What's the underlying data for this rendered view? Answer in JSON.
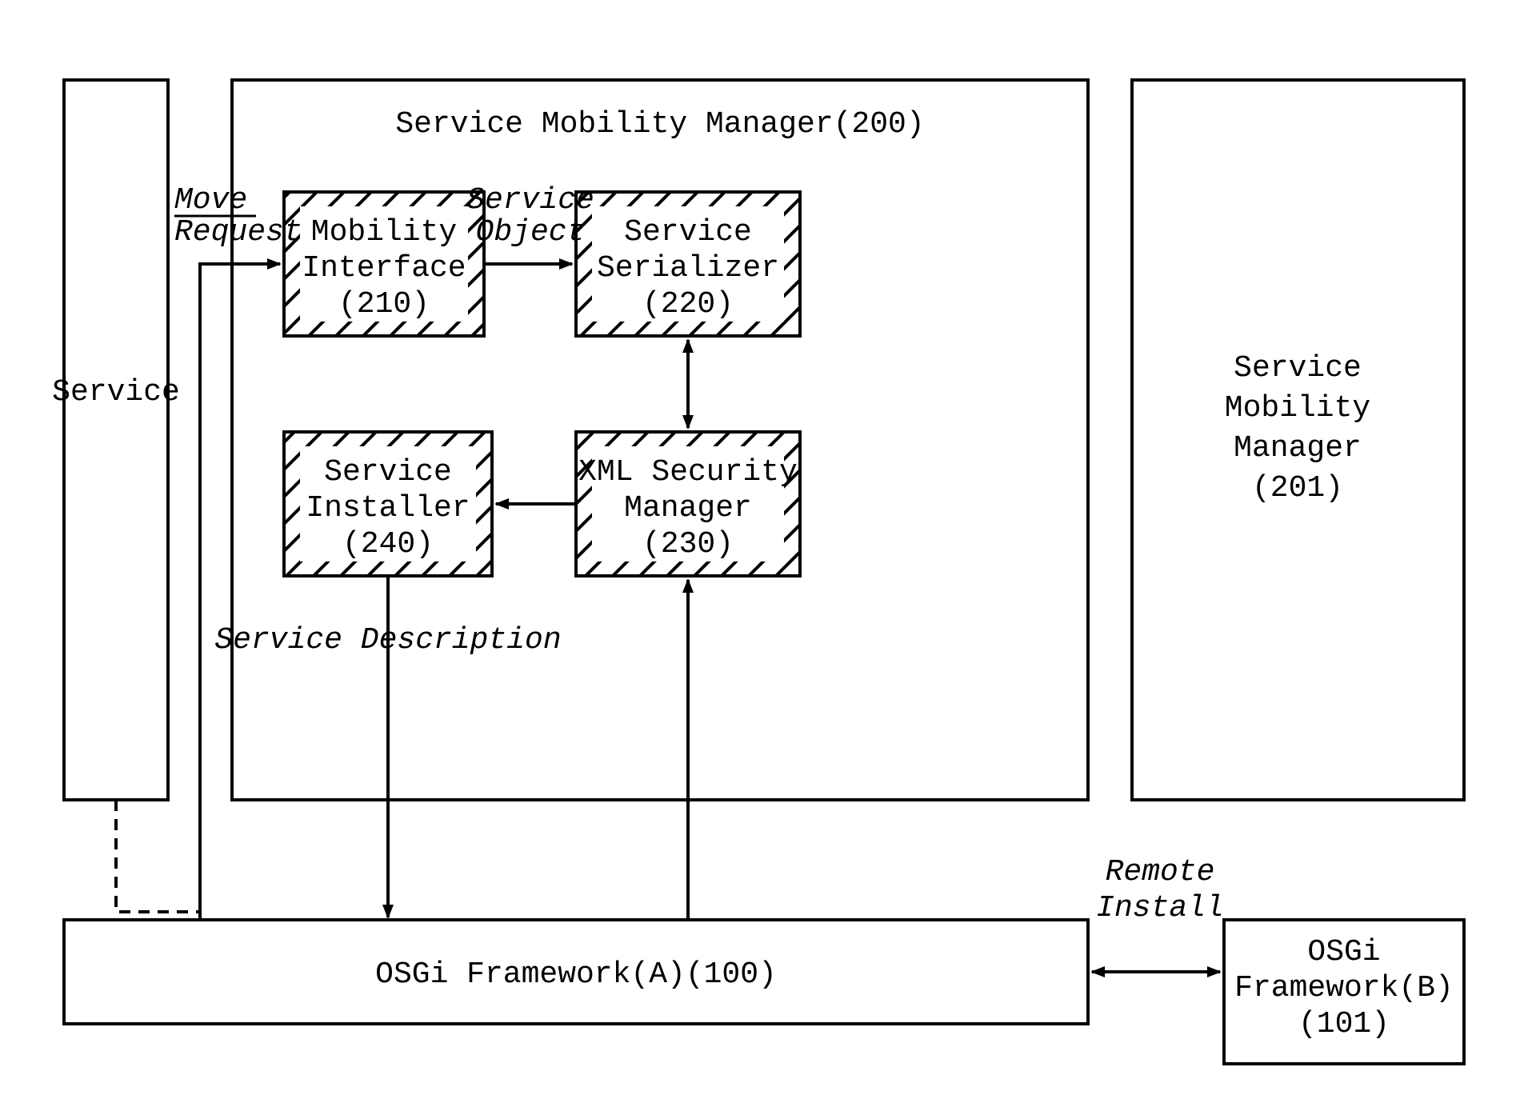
{
  "blocks": {
    "service": {
      "line1": "Service"
    },
    "smm200": {
      "title": "Service Mobility Manager(200)",
      "mi": {
        "l1": "Mobility",
        "l2": "Interface",
        "l3": "(210)"
      },
      "ss": {
        "l1": "Service",
        "l2": "Serializer",
        "l3": "(220)"
      },
      "xs": {
        "l1": "XML Security",
        "l2": "Manager",
        "l3": "(230)"
      },
      "si": {
        "l1": "Service",
        "l2": "Installer",
        "l3": "(240)"
      }
    },
    "smm201": {
      "l1": "Service",
      "l2": "Mobility",
      "l3": "Manager",
      "l4": "(201)"
    },
    "osgiA": "OSGi Framework(A)(100)",
    "osgiB": {
      "l1": "OSGi",
      "l2": "Framework(B)",
      "l3": "(101)"
    }
  },
  "edges": {
    "moveRequest": {
      "l1": "Move",
      "l2": "Request"
    },
    "serviceObject": {
      "l1": "Service",
      "l2": "Object"
    },
    "serviceDescription": "Service Description",
    "remoteInstall": {
      "l1": "Remote",
      "l2": "Install"
    }
  }
}
